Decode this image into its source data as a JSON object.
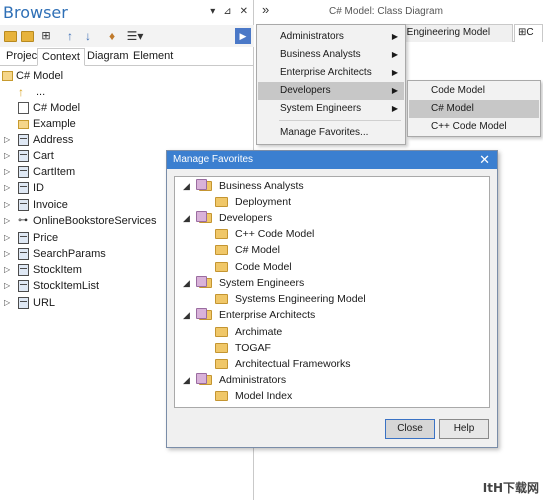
{
  "browser": {
    "title": "Browser",
    "controls": [
      "▾",
      "⊿",
      "✕"
    ],
    "tabs": [
      "Project",
      "Context",
      "Diagram",
      "Element"
    ],
    "root": "C# Model",
    "items": [
      {
        "label": "...",
        "icon": "up-arrow-icon"
      },
      {
        "label": "C# Model",
        "icon": "diagram-icon"
      },
      {
        "label": "Example",
        "icon": "folder-icon"
      },
      {
        "label": "Address",
        "icon": "class-icon"
      },
      {
        "label": "Cart",
        "icon": "class-icon"
      },
      {
        "label": "CartItem",
        "icon": "class-icon"
      },
      {
        "label": "ID",
        "icon": "class-icon"
      },
      {
        "label": "Invoice",
        "icon": "class-icon"
      },
      {
        "label": "OnlineBookstoreServices",
        "icon": "interface-icon"
      },
      {
        "label": "Price",
        "icon": "class-icon"
      },
      {
        "label": "SearchParams",
        "icon": "class-icon"
      },
      {
        "label": "StockItem",
        "icon": "class-icon"
      },
      {
        "label": "StockItemList",
        "icon": "class-icon"
      },
      {
        "label": "URL",
        "icon": "class-icon"
      }
    ]
  },
  "diagram": {
    "title": "C# Model:  Class Diagram",
    "tabs": [
      "ems Engineering Model",
      "C"
    ]
  },
  "menu": {
    "items": [
      "Administrators",
      "Business Analysts",
      "Enterprise Architects",
      "Developers",
      "System Engineers",
      "Manage Favorites..."
    ],
    "highlighted": "Developers"
  },
  "submenu": {
    "items": [
      "Code Model",
      "C# Model",
      "C++ Code Model"
    ],
    "highlighted": "C# Model"
  },
  "dialog": {
    "title": "Manage Favorites",
    "close_label": "Close",
    "help_label": "Help",
    "groups": [
      {
        "label": "Business Analysts",
        "children": [
          "Deployment"
        ]
      },
      {
        "label": "Developers",
        "children": [
          "C++ Code Model",
          "C# Model",
          "Code Model"
        ]
      },
      {
        "label": "System Engineers",
        "children": [
          "Systems Engineering Model"
        ]
      },
      {
        "label": "Enterprise Architects",
        "children": [
          "Archimate",
          "TOGAF",
          "Architectual Frameworks"
        ]
      },
      {
        "label": "Administrators",
        "children": [
          "Model Index"
        ]
      }
    ]
  },
  "watermark": "ItH下载网"
}
